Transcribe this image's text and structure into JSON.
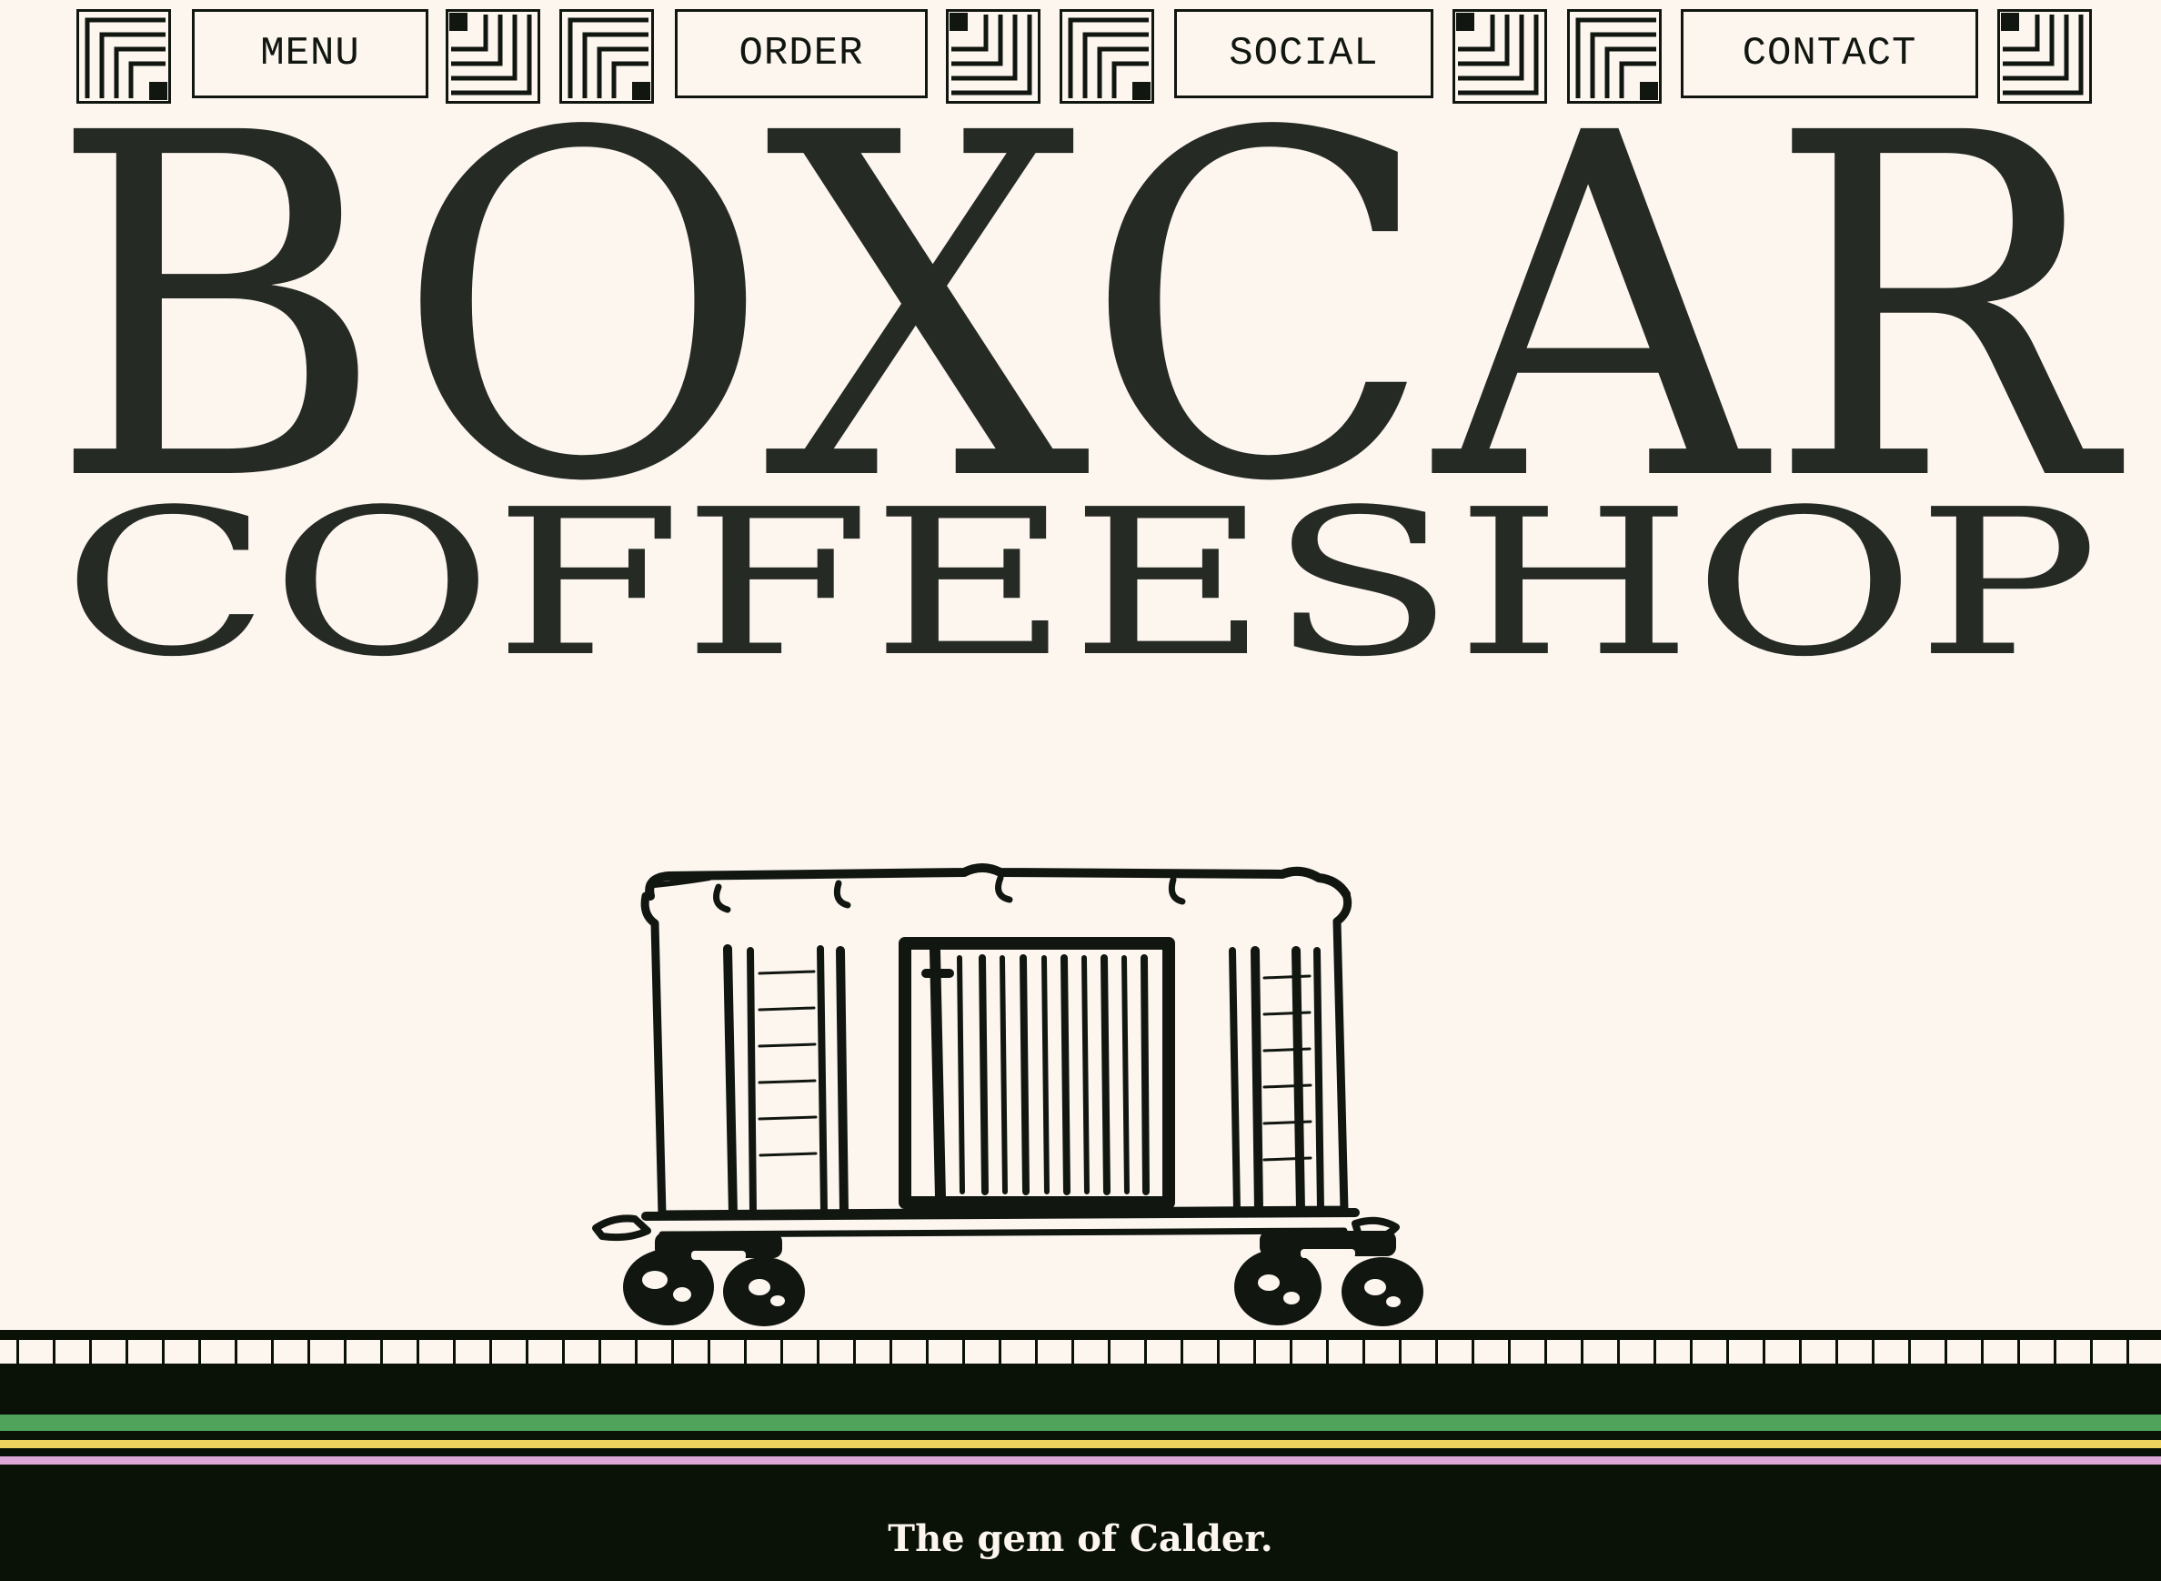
{
  "nav": {
    "items": [
      {
        "label": "MENU"
      },
      {
        "label": "ORDER"
      },
      {
        "label": "SOCIAL"
      },
      {
        "label": "CONTACT"
      }
    ]
  },
  "hero": {
    "title": "BOXCAR",
    "subtitle": "COFFEESHOP"
  },
  "footer": {
    "tagline": "The gem of Calder."
  },
  "colors": {
    "background": "#fcf6ee",
    "ink": "#262a25",
    "band": "#0a1208",
    "stripe_green": "#4fa35a",
    "stripe_yellow": "#efd35f",
    "stripe_pink": "#dca6d6"
  },
  "icons": [
    "corner-pattern-icon",
    "boxcar-illustration"
  ]
}
